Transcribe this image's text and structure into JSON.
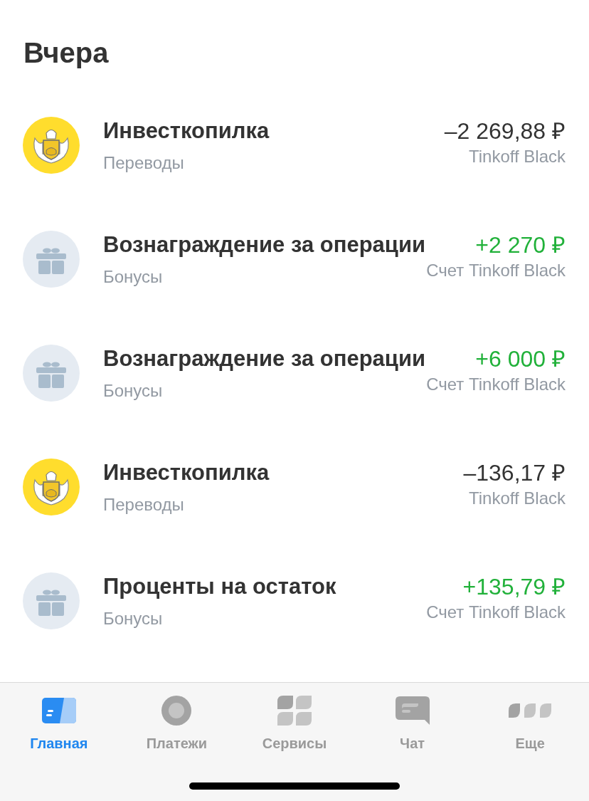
{
  "section": {
    "title": "Вчера"
  },
  "operations": [
    {
      "kind": "bank",
      "title": "Инвесткопилка",
      "category": "Переводы",
      "amount": "–2 269,88 ₽",
      "income": false,
      "account": "Tinkoff Black"
    },
    {
      "kind": "bonus",
      "title": "Вознаграждение за операции",
      "category": "Бонусы",
      "amount": "+2 270 ₽",
      "income": true,
      "account": "Счет Tinkoff Black"
    },
    {
      "kind": "bonus",
      "title": "Вознаграждение за операции",
      "category": "Бонусы",
      "amount": "+6 000 ₽",
      "income": true,
      "account": "Счет Tinkoff Black"
    },
    {
      "kind": "bank",
      "title": "Инвесткопилка",
      "category": "Переводы",
      "amount": "–136,17 ₽",
      "income": false,
      "account": "Tinkoff Black"
    },
    {
      "kind": "bonus",
      "title": "Проценты на остаток",
      "category": "Бонусы",
      "amount": "+135,79 ₽",
      "income": true,
      "account": "Счет Tinkoff Black"
    }
  ],
  "tab_bar": {
    "tabs": [
      {
        "kind": "card",
        "label": "Главная",
        "selected": true
      },
      {
        "kind": "ring",
        "label": "Платежи",
        "selected": false
      },
      {
        "kind": "grid",
        "label": "Сервисы",
        "selected": false
      },
      {
        "kind": "chat",
        "label": "Чат",
        "selected": false
      },
      {
        "kind": "more",
        "label": "Еще",
        "selected": false
      }
    ]
  }
}
